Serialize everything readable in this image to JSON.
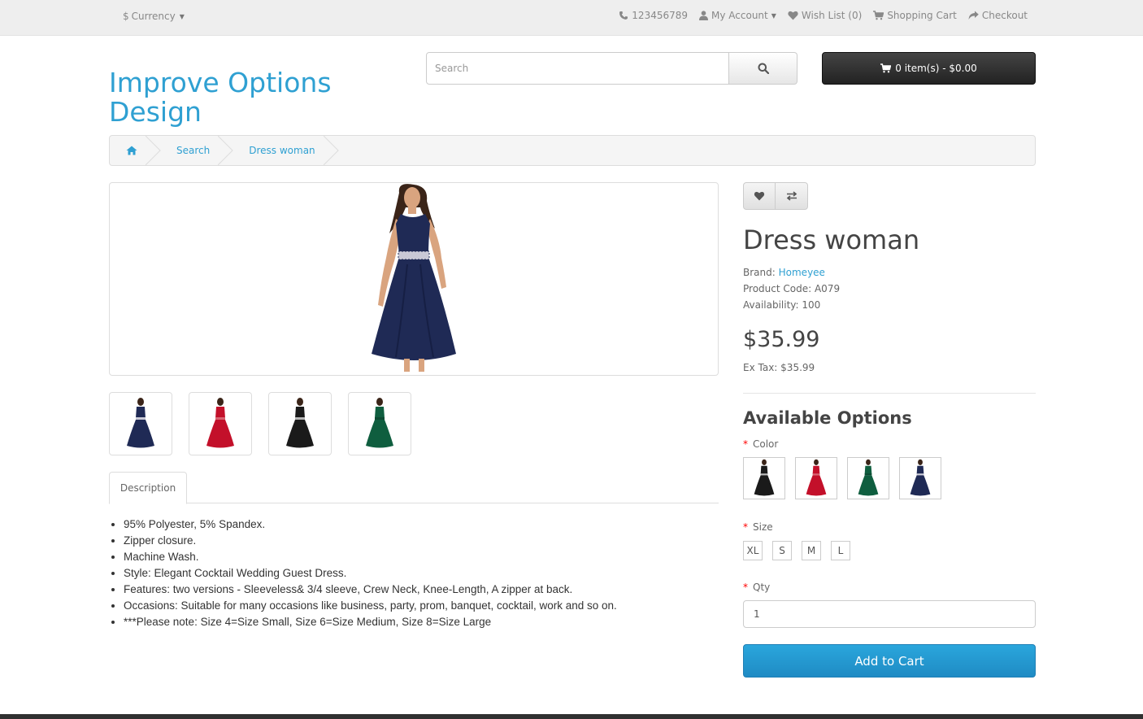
{
  "topbar": {
    "currency_label": "Currency",
    "currency_symbol": "$",
    "phone": "123456789",
    "my_account": "My Account",
    "wish_list": "Wish List (0)",
    "shopping_cart": "Shopping Cart",
    "checkout": "Checkout"
  },
  "header": {
    "logo_text": "Improve Options Design",
    "search_placeholder": "Search",
    "cart_summary": "0 item(s) - $0.00"
  },
  "breadcrumb": {
    "items": [
      "Search",
      "Dress woman"
    ]
  },
  "product": {
    "title": "Dress woman",
    "brand_label": "Brand:",
    "brand": "Homeyee",
    "code_label": "Product Code:",
    "code": "A079",
    "availability_label": "Availability:",
    "availability": "100",
    "price": "$35.99",
    "ex_tax_label": "Ex Tax:",
    "ex_tax": "$35.99"
  },
  "thumbnails": [
    {
      "color": "#1f2a55"
    },
    {
      "color": "#c3102a"
    },
    {
      "color": "#1a1a1a"
    },
    {
      "color": "#0f5e3f"
    }
  ],
  "tabs": {
    "description": "Description"
  },
  "description": [
    "95% Polyester, 5% Spandex.",
    "Zipper closure.",
    "Machine Wash.",
    "Style: Elegant Cocktail Wedding Guest Dress.",
    "Features: two versions - Sleeveless& 3/4 sleeve, Crew Neck, Knee-Length, A zipper at back.",
    "Occasions: Suitable for many occasions like business, party, prom, banquet, cocktail, work and so on.",
    "***Please note: Size 4=Size Small, Size 6=Size Medium, Size 8=Size Large"
  ],
  "options": {
    "heading": "Available Options",
    "required_mark": "*",
    "color_label": "Color",
    "color_swatches": [
      {
        "color": "#1a1a1a"
      },
      {
        "color": "#c3102a"
      },
      {
        "color": "#0f5e3f"
      },
      {
        "color": "#1f2a55"
      }
    ],
    "size_label": "Size",
    "sizes": [
      "XL",
      "S",
      "M",
      "L"
    ],
    "qty_label": "Qty",
    "qty_value": "1",
    "add_to_cart": "Add to Cart"
  },
  "colors": {
    "accent": "#2fa0d2",
    "cart_button": "#222222",
    "add_to_cart": "#229ad3"
  }
}
